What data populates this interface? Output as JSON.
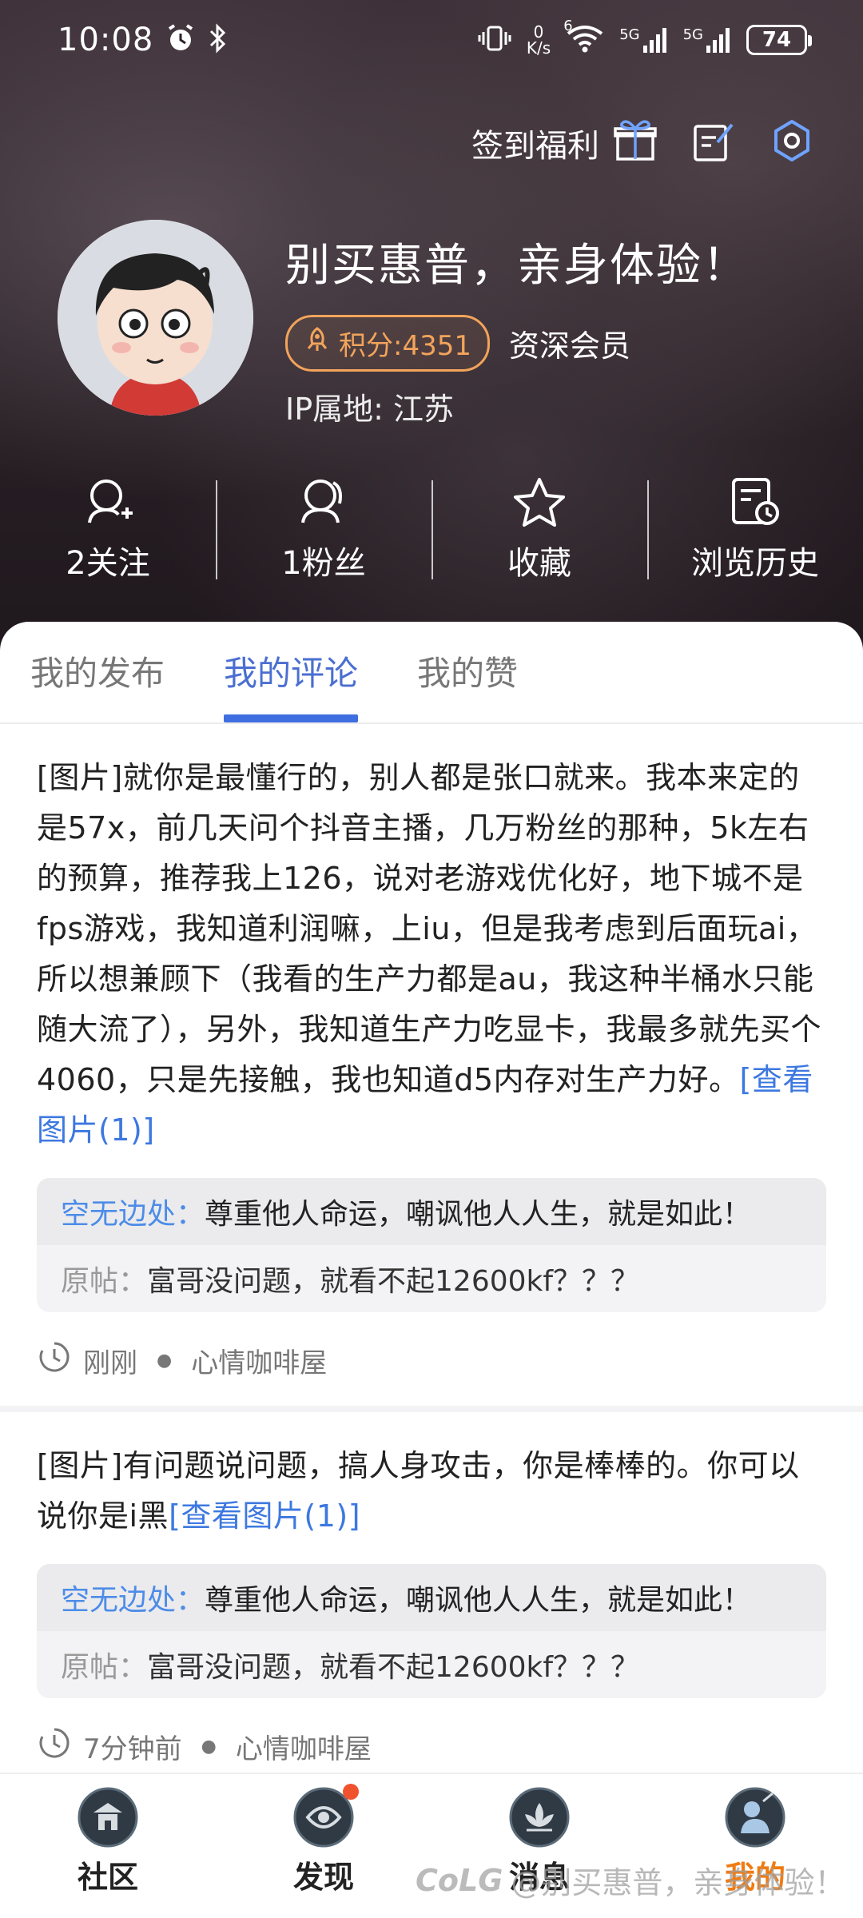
{
  "status_bar": {
    "time": "10:08",
    "net_speed_value": "0",
    "net_speed_unit": "K/s",
    "wifi_badge": "6",
    "sim1_label": "5G",
    "sim2_label": "5G",
    "battery": "74"
  },
  "header": {
    "checkin_label": "签到福利",
    "username": "别买惠普，亲身体验！",
    "points": "积分:4351",
    "member_level": "资深会员",
    "ip_location": "IP属地: 江苏"
  },
  "stats": [
    {
      "label": "2关注",
      "icon": "follow-icon"
    },
    {
      "label": "1粉丝",
      "icon": "fans-icon"
    },
    {
      "label": "收藏",
      "icon": "star-icon"
    },
    {
      "label": "浏览历史",
      "icon": "history-icon"
    }
  ],
  "tabs": [
    {
      "label": "我的发布",
      "active": false
    },
    {
      "label": "我的评论",
      "active": true
    },
    {
      "label": "我的赞",
      "active": false
    }
  ],
  "comments": [
    {
      "text": "[图片]就你是最懂行的，别人都是张口就来。我本来定的是57x，前几天问个抖音主播，几万粉丝的那种，5k左右的预算，推荐我上126，说对老游戏优化好，地下城不是fps游戏，我知道利润嘛，上iu，但是我考虑到后面玩ai，所以想兼顾下（我看的生产力都是au，我这种半桶水只能随大流了），另外，我知道生产力吃显卡，我最多就先买个4060，只是先接触，我也知道d5内存对生产力好。",
      "view_image": "[查看图片(1)]",
      "reply_user": "空无边处：",
      "reply_text": "尊重他人命运，嘲讽他人人生，就是如此！",
      "original_label": "原帖：",
      "original_text": "富哥没问题，就看不起12600kf？？？",
      "time": "刚刚",
      "forum": "心情咖啡屋"
    },
    {
      "text": "[图片]有问题说问题，搞人身攻击，你是棒棒的。你可以说你是i黑",
      "view_image": "[查看图片(1)]",
      "reply_user": "空无边处：",
      "reply_text": "尊重他人命运，嘲讽他人人生，就是如此！",
      "original_label": "原帖：",
      "original_text": "富哥没问题，就看不起12600kf？？？",
      "time": "7分钟前",
      "forum": "心情咖啡屋"
    }
  ],
  "bottom_nav": [
    {
      "label": "社区",
      "active": false,
      "badge": false
    },
    {
      "label": "发现",
      "active": false,
      "badge": true
    },
    {
      "label": "消息",
      "active": false,
      "badge": false
    },
    {
      "label": "我的",
      "active": true,
      "badge": false
    }
  ],
  "watermark": {
    "logo": "CoLG",
    "text": "@别买惠普，亲身体验！"
  },
  "colors": {
    "accent_blue": "#3f6ee0",
    "points_orange": "#f2a45b",
    "active_nav": "#f07b12",
    "link_blue": "#3d78e0"
  }
}
